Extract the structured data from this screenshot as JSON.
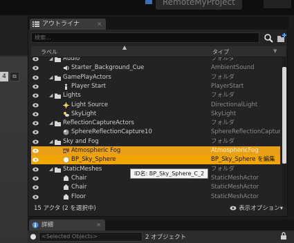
{
  "window": {
    "project_title": "RemoteMyProject"
  },
  "viewport": {
    "badge": "4",
    "button": "⧉"
  },
  "outliner": {
    "tab_label": "アウトライナ",
    "tab_close": "×",
    "search_placeholder": "検索...",
    "columns": {
      "label": "ラベル",
      "type": "タイプ"
    },
    "rows": [
      {
        "name": "Audio",
        "type": "フォルダ",
        "indent": 2,
        "kind": "folder",
        "partial": true
      },
      {
        "name": "Starter_Background_Cue",
        "type": "AmbientSound",
        "indent": 3,
        "kind": "sound"
      },
      {
        "name": "GamePlayActors",
        "type": "フォルダ",
        "indent": 2,
        "kind": "folder"
      },
      {
        "name": "Player Start",
        "type": "PlayerStart",
        "indent": 3,
        "kind": "player"
      },
      {
        "name": "Lights",
        "type": "フォルダ",
        "indent": 2,
        "kind": "folder"
      },
      {
        "name": "Light Source",
        "type": "DirectionalLight",
        "indent": 3,
        "kind": "light"
      },
      {
        "name": "SkyLight",
        "type": "SkyLight",
        "indent": 3,
        "kind": "sky"
      },
      {
        "name": "ReflectionCaptureActors",
        "type": "フォルダ",
        "indent": 2,
        "kind": "folder"
      },
      {
        "name": "SphereReflectionCapture10",
        "type": "SphereReflectionCaptur",
        "indent": 3,
        "kind": "sphere"
      },
      {
        "name": "Sky and Fog",
        "type": "フォルダ",
        "indent": 2,
        "kind": "folder"
      },
      {
        "name": "Atmospheric Fog",
        "type": "AtmosphericFog",
        "indent": 3,
        "kind": "fog",
        "selected": "sel"
      },
      {
        "name": "BP_Sky_Sphere",
        "type": "BP_Sky_Sphere を編集",
        "indent": 3,
        "kind": "bp",
        "selected": "sel2"
      },
      {
        "name": "StaticMeshes",
        "type": "フォルダ",
        "indent": 2,
        "kind": "folder"
      },
      {
        "name": "Chair",
        "type": "StaticMeshActor",
        "indent": 3,
        "kind": "mesh"
      },
      {
        "name": "Chair",
        "type": "StaticMeshActor",
        "indent": 3,
        "kind": "mesh"
      },
      {
        "name": "Floor",
        "type": "StaticMeshActor",
        "indent": 3,
        "kind": "mesh",
        "partial": true
      }
    ],
    "tooltip": "ID名: BP_Sky_Sphere_C_2",
    "status_count": "15 アクタ (2 を選択中)",
    "view_options": "表示オプション▾"
  },
  "details": {
    "tab_label": "詳細",
    "tab_close": "×",
    "selected_placeholder": "<Selected Objects>",
    "object_count": "2 オブジェクト"
  },
  "colors": {
    "selection": "#e9a016",
    "selection_active": "#f0a500",
    "panel": "#232323"
  }
}
